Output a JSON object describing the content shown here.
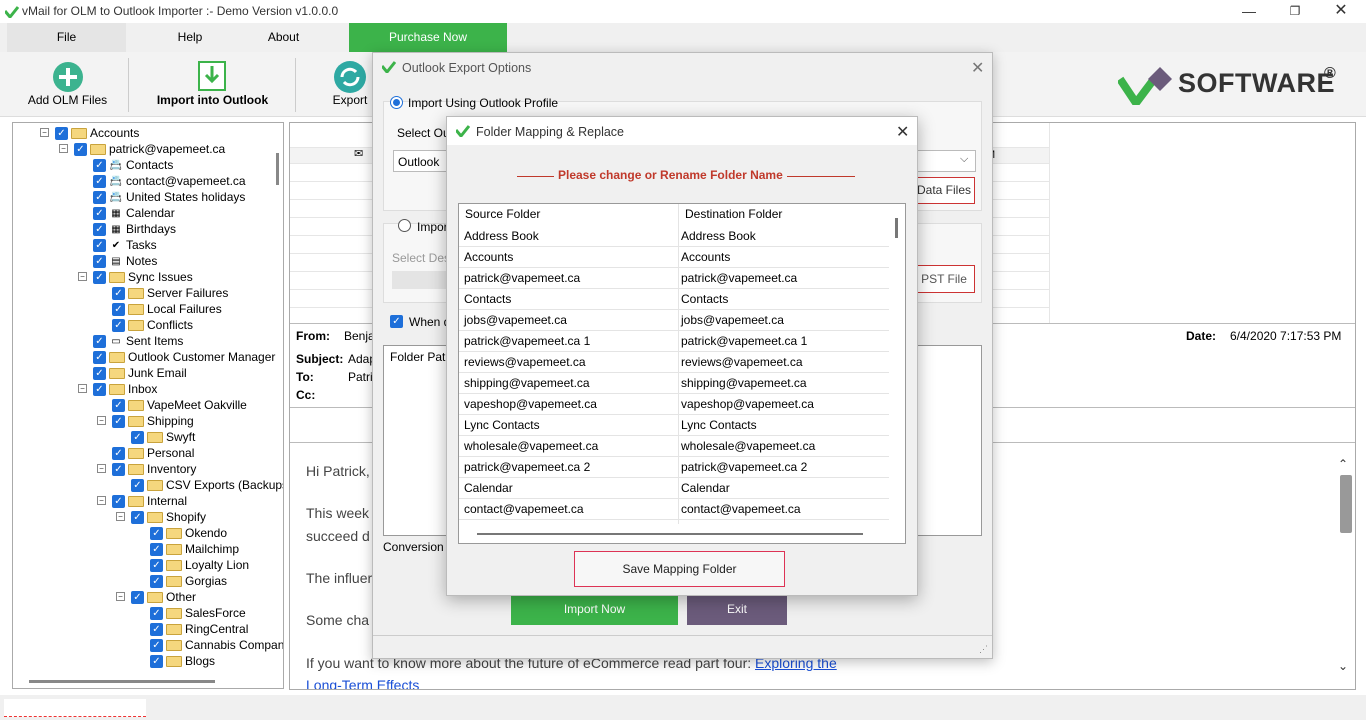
{
  "window": {
    "title": "vMail for OLM to Outlook Importer :- Demo Version v1.0.0.0"
  },
  "menu": {
    "file": "File",
    "help": "Help",
    "about": "About",
    "purchase": "Purchase Now"
  },
  "toolbar": {
    "add_olm": "Add OLM Files",
    "import": "Import into Outlook",
    "export": "Export",
    "brand": "SOFTWARE",
    "brand_reg": "®"
  },
  "tree": {
    "items": [
      {
        "label": "Accounts"
      },
      {
        "label": "patrick@vapemeet.ca"
      },
      {
        "label": "Contacts"
      },
      {
        "label": "contact@vapemeet.ca"
      },
      {
        "label": "United States holidays"
      },
      {
        "label": "Calendar"
      },
      {
        "label": "Birthdays"
      },
      {
        "label": "Tasks"
      },
      {
        "label": "Notes"
      },
      {
        "label": "Sync Issues"
      },
      {
        "label": "Server Failures"
      },
      {
        "label": "Local Failures"
      },
      {
        "label": "Conflicts"
      },
      {
        "label": "Sent Items"
      },
      {
        "label": "Outlook Customer Manager"
      },
      {
        "label": "Junk Email"
      },
      {
        "label": "Inbox"
      },
      {
        "label": "VapeMeet Oakville"
      },
      {
        "label": "Shipping"
      },
      {
        "label": "Swyft"
      },
      {
        "label": "Personal"
      },
      {
        "label": "Inventory"
      },
      {
        "label": "CSV Exports (Backups"
      },
      {
        "label": "Internal"
      },
      {
        "label": "Shopify"
      },
      {
        "label": "Okendo"
      },
      {
        "label": "Mailchimp"
      },
      {
        "label": "Loyalty Lion"
      },
      {
        "label": "Gorgias"
      },
      {
        "label": "Other"
      },
      {
        "label": "SalesForce"
      },
      {
        "label": "RingCentral"
      },
      {
        "label": "Cannabis Compan"
      },
      {
        "label": "Blogs"
      }
    ]
  },
  "message": {
    "from_label": "From:",
    "from_value": "Benjar",
    "subject_label": "Subject:",
    "subject_value": "Adap",
    "to_label": "To:",
    "to_value": "Patric",
    "cc_label": "Cc:",
    "date_label": "Date:",
    "date_value": "6/4/2020 7:17:53 PM",
    "list_time": "M",
    "body": [
      "Hi Patrick,",
      "This week",
      "succeed d",
      "The influer",
      "Some cha"
    ],
    "footer_text": "If you want to know more about the future of eCommerce read part four: ",
    "footer_link1": "Exploring the",
    "footer_link2": "Long-Term Effects"
  },
  "export_dialog": {
    "title": "Outlook Export Options",
    "opt_profile": "Import Using Outlook Profile",
    "select_label": "Select Out",
    "select_value": "Outlook",
    "data_files_btn": "Data Files",
    "opt_import": "Import",
    "select_dest": "Select Dest",
    "pst_btn": "PST File",
    "when_label": "When d",
    "folder_path": "Folder Path",
    "conversion": "Conversion",
    "import_btn": "Import Now",
    "exit_btn": "Exit"
  },
  "mapping_dialog": {
    "title": "Folder Mapping & Replace",
    "heading": "Please change or Rename Folder Name",
    "col_source": "Source Folder",
    "col_dest": "Destination Folder",
    "rows": [
      {
        "src": "Address Book",
        "dst": "Address Book"
      },
      {
        "src": "Accounts",
        "dst": "Accounts"
      },
      {
        "src": "patrick@vapemeet.ca",
        "dst": "patrick@vapemeet.ca"
      },
      {
        "src": "Contacts",
        "dst": "Contacts"
      },
      {
        "src": "jobs@vapemeet.ca",
        "dst": "jobs@vapemeet.ca"
      },
      {
        "src": "patrick@vapemeet.ca 1",
        "dst": "patrick@vapemeet.ca 1"
      },
      {
        "src": "reviews@vapemeet.ca",
        "dst": "reviews@vapemeet.ca"
      },
      {
        "src": "shipping@vapemeet.ca",
        "dst": "shipping@vapemeet.ca"
      },
      {
        "src": "vapeshop@vapemeet.ca",
        "dst": "vapeshop@vapemeet.ca"
      },
      {
        "src": "Lync Contacts",
        "dst": "Lync Contacts"
      },
      {
        "src": "wholesale@vapemeet.ca",
        "dst": "wholesale@vapemeet.ca"
      },
      {
        "src": "patrick@vapemeet.ca 2",
        "dst": "patrick@vapemeet.ca 2"
      },
      {
        "src": "Calendar",
        "dst": "Calendar"
      },
      {
        "src": "contact@vapemeet.ca",
        "dst": "contact@vapemeet.ca"
      }
    ],
    "save_btn": "Save Mapping Folder"
  },
  "colors": {
    "accent_green": "#3cb34a",
    "brand_purple": "#6b5b7b",
    "heading_red": "#c0392b",
    "checkbox_blue": "#1e6fd9"
  }
}
